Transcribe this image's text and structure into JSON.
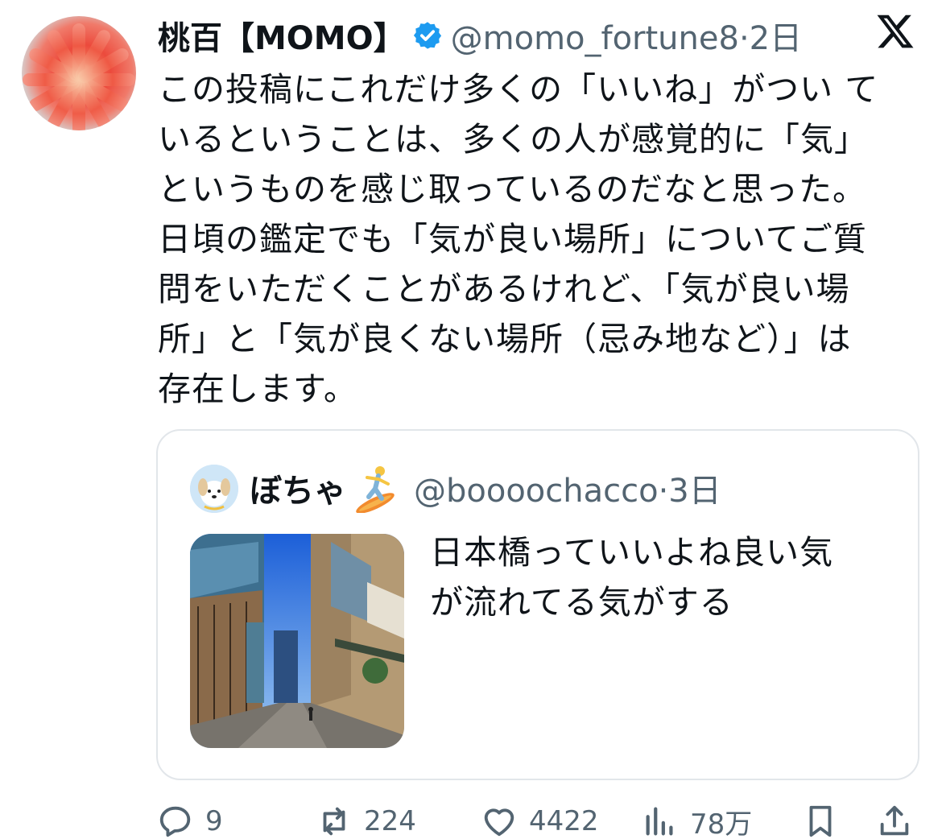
{
  "tweet": {
    "display_name": "桃百【MOMO】",
    "handle_time": "@momo_fortune8·2日",
    "text_lines": [
      "この投稿にこれだけ多くの「いいね」がつい て",
      "いるということは、多くの人が感覚的に「気」",
      "というものを感じ取っているのだなと思った。",
      "日頃の鑑定でも「気が良い場所」についてご質",
      "問をいただくことがあるけれど、「気が良い場",
      "所」と「気が良くない場所（忌み地など）」は",
      "存在します。"
    ]
  },
  "quote": {
    "display_name": "ぼちゃ",
    "handle_time": "@boooochacco·3日",
    "text_lines": [
      "日本橋っていいよね良い気",
      "が流れてる気がする"
    ]
  },
  "actions": {
    "replies": "9",
    "reposts": "224",
    "likes": "4422",
    "views": "78万"
  },
  "icons": {
    "verified": "verified-badge-icon",
    "platform": "x-logo-icon",
    "surfer": "surfer-emoji-icon"
  },
  "colors": {
    "verified": "#1d9bf0",
    "secondary_text": "#536471",
    "primary_text": "#0f1419"
  }
}
